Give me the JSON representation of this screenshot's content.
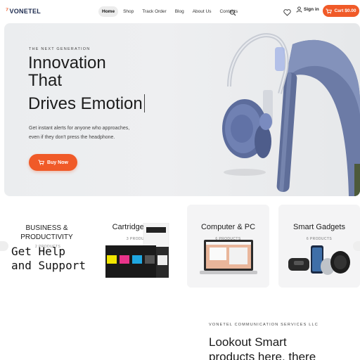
{
  "brand": {
    "logo_text": "VONETEL",
    "accent": "#f05a28"
  },
  "nav": {
    "items": [
      "Home",
      "Shop",
      "Track Order",
      "Blog",
      "About Us",
      "Contacts"
    ],
    "active_index": 0
  },
  "header_actions": {
    "signin_label": "Sign in",
    "cart_label": "Cart $0.00"
  },
  "hero": {
    "eyebrow": "THE NEXT GENERATION",
    "headline_line1": "Innovation",
    "headline_line2": "That",
    "headline_line3": "Drives Emotion",
    "subtext_line1": "Get instant alerts for anyone who approaches,",
    "subtext_line2": "even if they don't press the headphone.",
    "button_label": "Buy Now"
  },
  "categories": {
    "items": [
      {
        "title_line1": "BUSINESS &",
        "title_line2": "PRODUCTIVITY",
        "count": "2 PRODUCTS"
      },
      {
        "title": "Cartridge World",
        "count": "3 PRODUCTS"
      },
      {
        "title": "Computer & PC",
        "count": "6 PRODUCTS"
      },
      {
        "title": "Smart Gadgets",
        "count": "6 PRODUCTS"
      }
    ],
    "overlay_line1": "Get Help",
    "overlay_line2": "and Support"
  },
  "promo": {
    "eyebrow": "VONETEL COMMUNICATION SERVICES LLC",
    "title_line1": "Lookout Smart",
    "title_line2": "products here, there"
  },
  "icons": [
    "logo-mark-icon",
    "search-icon",
    "heart-icon",
    "user-icon",
    "cart-icon",
    "chevron-left-icon",
    "chevron-right-icon"
  ]
}
